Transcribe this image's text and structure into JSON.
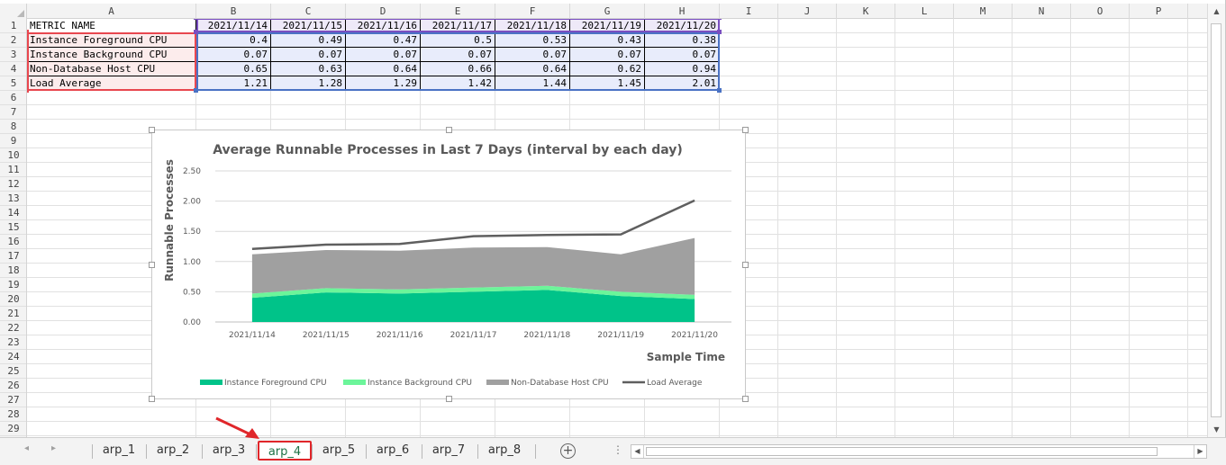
{
  "column_headers": [
    "A",
    "B",
    "C",
    "D",
    "E",
    "F",
    "G",
    "H",
    "I",
    "J",
    "K",
    "L",
    "M",
    "N",
    "O",
    "P"
  ],
  "row_headers": [
    "1",
    "2",
    "3",
    "4",
    "5",
    "6",
    "7",
    "8",
    "9",
    "10",
    "11",
    "12",
    "13",
    "14",
    "15",
    "16",
    "17",
    "18",
    "19",
    "20",
    "21",
    "22",
    "23",
    "24",
    "25",
    "26",
    "27",
    "28",
    "29"
  ],
  "table": {
    "corner_label": "METRIC NAME",
    "dates": [
      "2021/11/14",
      "2021/11/15",
      "2021/11/16",
      "2021/11/17",
      "2021/11/18",
      "2021/11/19",
      "2021/11/20"
    ],
    "rows": [
      {
        "name": "Instance Foreground CPU",
        "values": [
          "0.4",
          "0.49",
          "0.47",
          "0.5",
          "0.53",
          "0.43",
          "0.38"
        ]
      },
      {
        "name": "Instance Background CPU",
        "values": [
          "0.07",
          "0.07",
          "0.07",
          "0.07",
          "0.07",
          "0.07",
          "0.07"
        ]
      },
      {
        "name": "Non-Database Host CPU",
        "values": [
          "0.65",
          "0.63",
          "0.64",
          "0.66",
          "0.64",
          "0.62",
          "0.94"
        ]
      },
      {
        "name": "Load Average",
        "values": [
          "1.21",
          "1.28",
          "1.29",
          "1.42",
          "1.44",
          "1.45",
          "2.01"
        ]
      }
    ]
  },
  "chart_data": {
    "type": "area",
    "stacked": true,
    "title": "Average Runnable Processes in Last 7 Days (interval by each day)",
    "xlabel": "Sample Time",
    "ylabel": "Runnable Processes",
    "categories": [
      "2021/11/14",
      "2021/11/15",
      "2021/11/16",
      "2021/11/17",
      "2021/11/18",
      "2021/11/19",
      "2021/11/20"
    ],
    "y_ticks": [
      "0.00",
      "0.50",
      "1.00",
      "1.50",
      "2.00",
      "2.50"
    ],
    "ylim": [
      0,
      2.5
    ],
    "grid": true,
    "legend_position": "bottom",
    "series": [
      {
        "name": "Instance Foreground CPU",
        "kind": "area",
        "color": "#00c389",
        "values": [
          0.4,
          0.49,
          0.47,
          0.5,
          0.53,
          0.43,
          0.38
        ]
      },
      {
        "name": "Instance Background CPU",
        "kind": "area",
        "color": "#6cf59a",
        "values": [
          0.07,
          0.07,
          0.07,
          0.07,
          0.07,
          0.07,
          0.07
        ]
      },
      {
        "name": "Non-Database Host CPU",
        "kind": "area",
        "color": "#a0a0a0",
        "values": [
          0.65,
          0.63,
          0.64,
          0.66,
          0.64,
          0.62,
          0.94
        ]
      },
      {
        "name": "Load Average",
        "kind": "line",
        "color": "#5f5f5f",
        "values": [
          1.21,
          1.28,
          1.29,
          1.42,
          1.44,
          1.45,
          2.01
        ]
      }
    ]
  },
  "sheet_tabs": [
    "arp_1",
    "arp_2",
    "arp_3",
    "arp_4",
    "arp_5",
    "arp_6",
    "arp_7",
    "arp_8"
  ],
  "active_tab": "arp_4",
  "icons": {
    "nav_prev": "◂",
    "nav_next": "▸",
    "add_sheet": "+",
    "tab_options": "⋮",
    "scroll_up": "▲",
    "scroll_down": "▼",
    "scroll_left": "◀",
    "scroll_right": "▶"
  },
  "colors": {
    "highlight_red": "#e0262a",
    "name_range": "#e8474f",
    "value_range": "#4a72c4",
    "header_range": "#7a4fc0"
  }
}
